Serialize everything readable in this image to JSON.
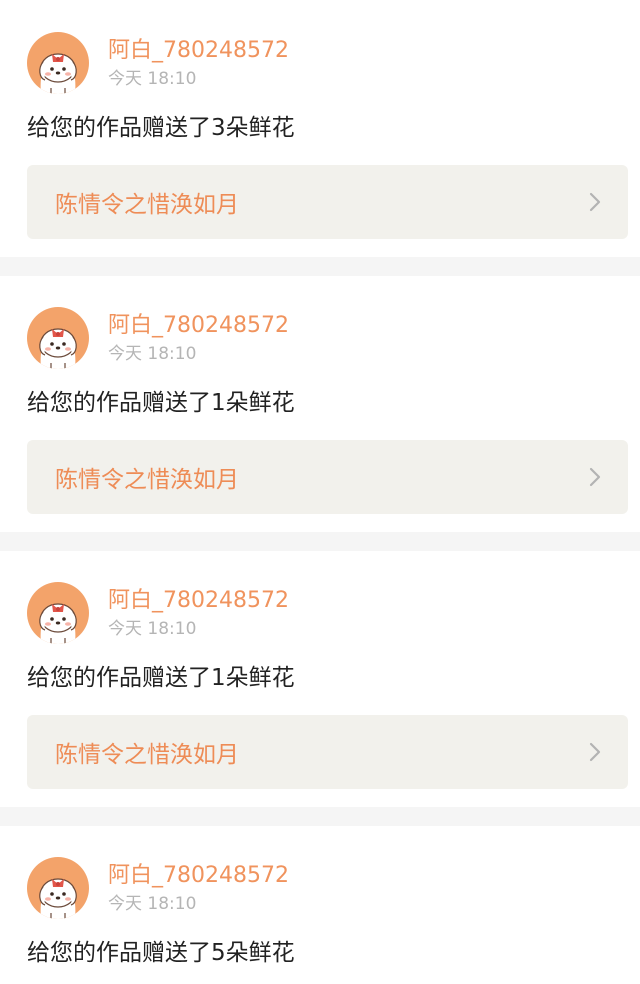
{
  "colors": {
    "accent": "#f0935d",
    "muted": "#b5b5b5",
    "link_bg": "#f2f1ec",
    "separator": "#f5f5f5"
  },
  "icons": {
    "avatar": "cartoon-dog-avatar-icon",
    "chevron": "chevron-right-icon"
  },
  "notifications": [
    {
      "username": "阿白_780248572",
      "time": "今天 18:10",
      "message": "给您的作品赠送了3朵鲜花",
      "work_title": "陈情令之惜涣如月"
    },
    {
      "username": "阿白_780248572",
      "time": "今天 18:10",
      "message": "给您的作品赠送了1朵鲜花",
      "work_title": "陈情令之惜涣如月"
    },
    {
      "username": "阿白_780248572",
      "time": "今天 18:10",
      "message": "给您的作品赠送了1朵鲜花",
      "work_title": "陈情令之惜涣如月"
    },
    {
      "username": "阿白_780248572",
      "time": "今天 18:10",
      "message": "给您的作品赠送了5朵鲜花"
    }
  ]
}
